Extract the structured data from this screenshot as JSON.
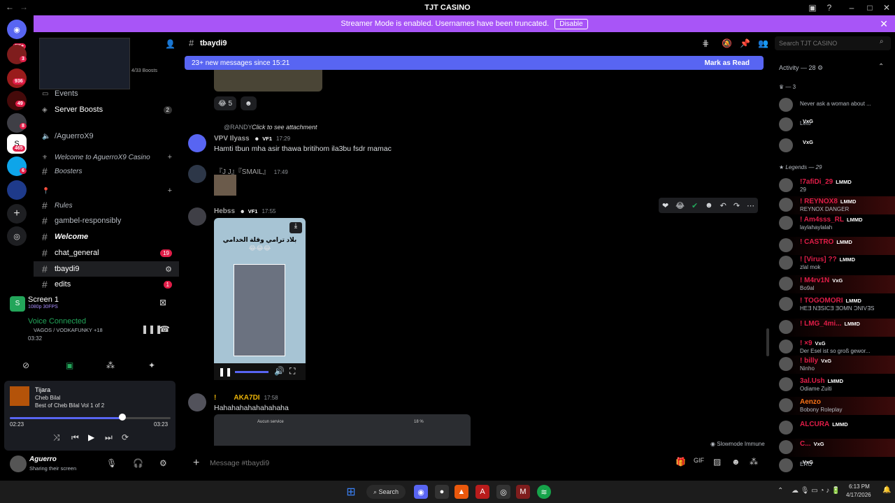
{
  "window": {
    "title": "TJT CASINO"
  },
  "banner": {
    "text": "Streamer Mode is enabled. Usernames have been truncated.",
    "button": "Disable"
  },
  "rail": {
    "home_badge": "1K+",
    "badges": [
      "3",
      "936",
      "49",
      "8",
      "465",
      "6"
    ]
  },
  "sidebar": {
    "boosts": "4/33 Boosts",
    "events": "Events",
    "server_boosts": "Server Boosts",
    "server_boosts_count": "2",
    "aguerro": "/AguerroX9",
    "category_welcome": "Welcome to AguerroX9 Casino",
    "boosters": "Boosters",
    "rules": "Rules",
    "gambel": "gambel-responsibly",
    "welcome": "Welcome",
    "chat_general": "chat_general",
    "chat_general_count": "19",
    "tbaydi9": "tbaydi9",
    "edits": "edits",
    "edits_count": "1"
  },
  "voice": {
    "screen": "Screen 1",
    "screen_quality": "1080p 30FPS",
    "status": "Voice Connected",
    "channel": "VAGOS / VODKAFUNKY +18",
    "timer": "03:32"
  },
  "player": {
    "title": "Tijara",
    "artist": "Cheb Bilal",
    "album": "Best of Cheb Bilal Vol 1 of 2",
    "elapsed": "02:23",
    "duration": "03:23",
    "progress": 0.7
  },
  "user": {
    "name": "Aguerro",
    "status": "Sharing their screen"
  },
  "chat": {
    "channel": "tbaydi9",
    "new_messages": "23+ new messages since 15:21",
    "mark_read": "Mark as Read",
    "reaction_count": "5",
    "reply_ref": "@RANDY",
    "reply_text": "Click to see attachment",
    "msg1_user": "VPV Ilyass",
    "msg1_tag": "VF1",
    "msg1_time": "17:29",
    "msg1_text": "Hamti tbun mha asir thawa britihom ila3bu fsdr mamac",
    "msg2_user": "『J J』『SMAIL』",
    "msg2_time": "17:49",
    "msg3_user": "Hebss",
    "msg3_tag": "VF1",
    "msg3_time": "17:55",
    "video_caption": "بلاد ترامي وقلة الخدامي",
    "msg4_user": "AKA7DI",
    "msg4_time": "17:58",
    "msg4_text": "Hahahahahahahahaha",
    "screenshot_text": "Aucun service",
    "screenshot_pct": "18 %",
    "slowmode": "Slowmode Immune",
    "placeholder": "Message #tbaydi9"
  },
  "members": {
    "search_placeholder": "Search TJT CASINO",
    "activity": "Activity — 28",
    "group1": "— 3",
    "legends": "Legends — 29",
    "list": [
      {
        "name": "",
        "status": "Never ask a woman about ...",
        "tag": ""
      },
      {
        "name": "",
        "status": "Leto",
        "tag": "VxG"
      },
      {
        "name": "",
        "status": "",
        "tag": "VxG"
      },
      {
        "name": "!7afiDi_29",
        "status": "29",
        "tag": "LMMD"
      },
      {
        "name": "! REYNOX8",
        "status": "REYNOX DANGER",
        "tag": "LMMD"
      },
      {
        "name": "! Am4sss_RL",
        "status": "laylahaylalah",
        "tag": "LMMD"
      },
      {
        "name": "! CASTRO",
        "status": "",
        "tag": "LMMD"
      },
      {
        "name": "! [Virus] ??",
        "status": "zlal mok",
        "tag": "LMMD"
      },
      {
        "name": "! M4rv1N",
        "status": "Bo9al",
        "tag": "VxG"
      },
      {
        "name": "! TOGOMORI",
        "status": "HEƎ NƎSICƎ ƎOMN ƆNIV∃S",
        "tag": "LMMD"
      },
      {
        "name": "! LMG_4mi...",
        "status": "",
        "tag": "LMMD"
      },
      {
        "name": "! ×9",
        "status": "Der Esel ist so groß gewor...",
        "tag": "VxG"
      },
      {
        "name": "! billy",
        "status": "Ninho",
        "tag": "VxG"
      },
      {
        "name": "3al.Ush",
        "status": "Odiame Zuiti",
        "tag": "LMMD"
      },
      {
        "name": "Aenzo",
        "status": "Bobony Roleplay",
        "tag": ""
      },
      {
        "name": "ALCURA",
        "status": "",
        "tag": "LMMD"
      },
      {
        "name": "C...",
        "status": "",
        "tag": "VxG"
      },
      {
        "name": "",
        "status": "ERO",
        "tag": "VxG"
      }
    ]
  },
  "taskbar": {
    "search": "Search",
    "time": "6:13 PM",
    "date": "4/17/2026"
  }
}
